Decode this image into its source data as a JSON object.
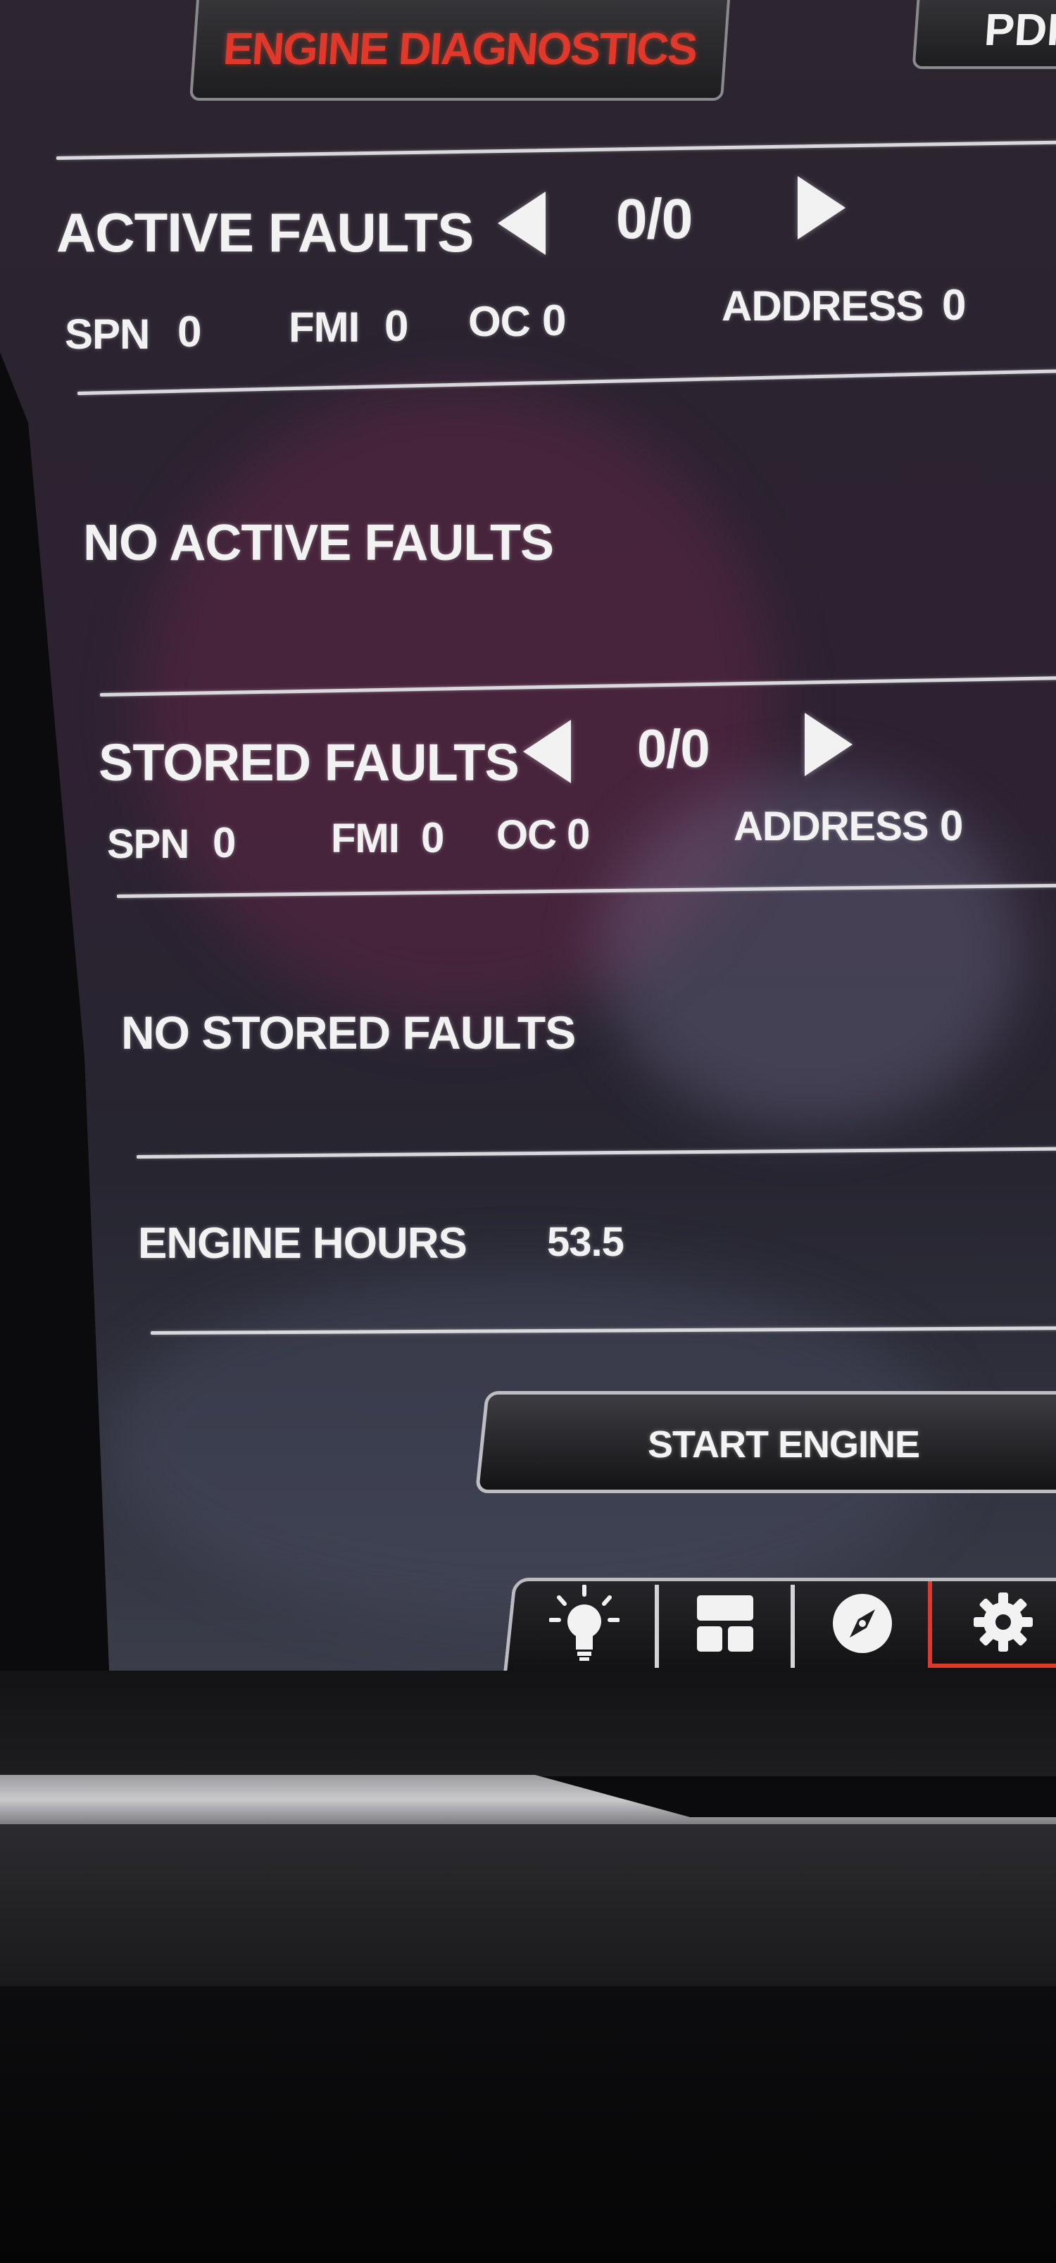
{
  "header": {
    "tab_active_label": "ENGINE DIAGNOSTICS",
    "tab_next_label": "PDI"
  },
  "active_faults": {
    "title": "ACTIVE FAULTS",
    "pager": "0/0",
    "spn_label": "SPN",
    "spn_value": "0",
    "fmi_label": "FMI",
    "fmi_value": "0",
    "oc_label": "OC",
    "oc_value": "0",
    "address_label": "ADDRESS",
    "address_value": "0",
    "message": "NO ACTIVE FAULTS"
  },
  "stored_faults": {
    "title": "STORED FAULTS",
    "pager": "0/0",
    "spn_label": "SPN",
    "spn_value": "0",
    "fmi_label": "FMI",
    "fmi_value": "0",
    "oc_label": "OC",
    "oc_value": "0",
    "address_label": "ADDRESS",
    "address_value": "0",
    "message": "NO STORED FAULTS"
  },
  "engine_hours": {
    "label": "ENGINE HOURS",
    "value": "53.5"
  },
  "start_engine_label": "START ENGINE",
  "nav_bar": {
    "items": [
      {
        "icon": "lightbulb-icon"
      },
      {
        "icon": "layout-icon"
      },
      {
        "icon": "compass-icon"
      },
      {
        "icon": "gear-icon"
      }
    ]
  },
  "colors": {
    "accent_red": "#e0392b",
    "text": "#f2f2f2",
    "divider": "#d9d9dd"
  }
}
